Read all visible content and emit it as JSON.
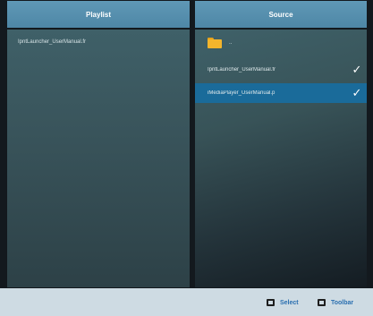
{
  "playlist": {
    "header": "Playlist",
    "items": [
      "IpntLauncher_UserManual.fr"
    ]
  },
  "source": {
    "header": "Source",
    "folder_label": "..",
    "items": [
      {
        "label": "IpntLauncher_UserManual.fr",
        "check": "✓",
        "selected": false
      },
      {
        "label": "iMediaPlayer_UserManual.p",
        "check": "✓",
        "selected": true
      }
    ]
  },
  "footer": {
    "select_label": "Select",
    "toolbar_label": "Toolbar"
  },
  "colors": {
    "header_blue": "#5a93b1",
    "selection_blue": "#1a6b9a",
    "footer_bg": "#cedbe3",
    "footer_text": "#2a6fb0",
    "folder_yellow": "#f4b52c"
  },
  "icons": {
    "folder": "folder-icon",
    "check": "checkmark-icon",
    "select": "select-button-icon",
    "toolbar": "toolbar-button-icon"
  }
}
